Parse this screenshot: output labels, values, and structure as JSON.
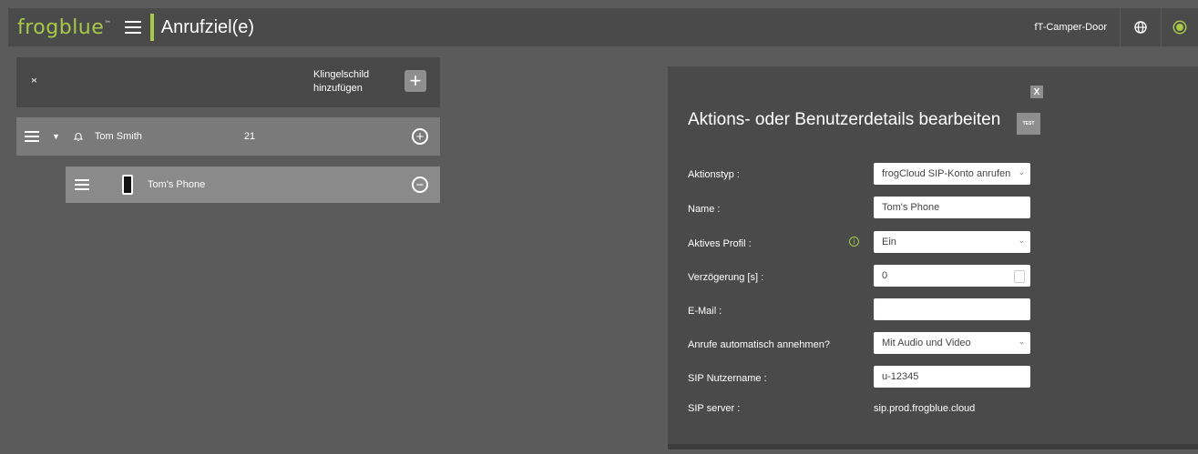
{
  "app": {
    "logo": "frogblue",
    "logo_tm": "™",
    "title": "Anrufziel(e)",
    "device": "fT-Camper-Door"
  },
  "toolbar": {
    "globe_icon": "globe-icon",
    "status_icon": "status-icon",
    "accent": "#a8c94a"
  },
  "list": {
    "add_label_line1": "Klingelschild",
    "add_label_line2": "hinzufügen",
    "add_symbol": "+",
    "contact": {
      "name": "Tom Smith",
      "number": "21",
      "add_symbol": "+"
    },
    "phone": {
      "name": "Tom's Phone",
      "remove_symbol": "−"
    }
  },
  "dialog": {
    "close": "X",
    "title": "Aktions- oder Benutzerdetails bearbeiten",
    "test": "TEST",
    "fields": {
      "action_type": {
        "label": "Aktionstyp :",
        "value": "frogCloud SIP-Konto anrufen"
      },
      "name": {
        "label": "Name :",
        "value": "Tom's Phone"
      },
      "active_profile": {
        "label": "Aktives Profil :",
        "value": "Ein"
      },
      "delay": {
        "label": "Verzögerung [s] :",
        "value": "0"
      },
      "email": {
        "label": "E-Mail :",
        "value": ""
      },
      "auto_answer": {
        "label": "Anrufe automatisch annehmen?",
        "value": "Mit Audio und Video"
      },
      "sip_user": {
        "label": "SIP Nutzername :",
        "value": "u-12345"
      },
      "sip_server": {
        "label": "SIP server :",
        "value": "sip.prod.frogblue.cloud"
      }
    }
  }
}
